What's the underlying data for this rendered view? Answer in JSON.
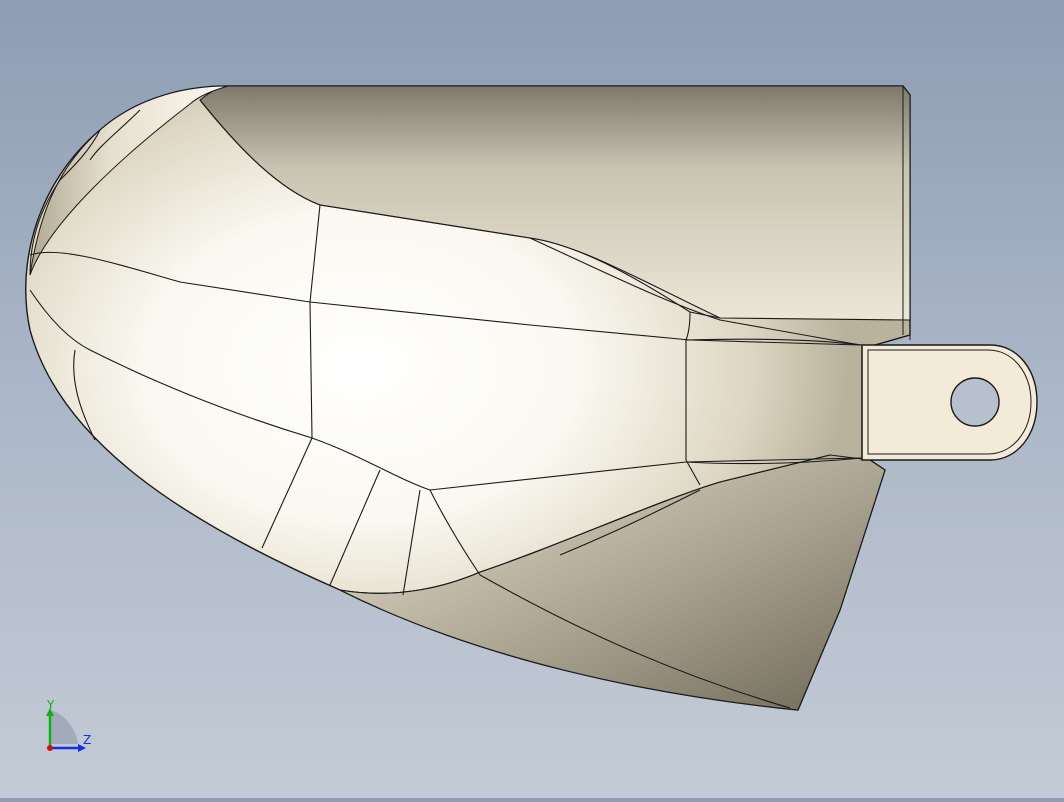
{
  "viewport": {
    "background_top": "#8e9db4",
    "background_bottom": "#c4cbd6",
    "model": {
      "icon": "cad-part-icon",
      "surface_color": "#efe9d8",
      "shadow_color": "#8e8672",
      "edge_color": "#1a1a1a"
    }
  },
  "triad": {
    "x_label": "",
    "y_label": "Y",
    "z_label": "Z",
    "x_color": "#d01010",
    "y_color": "#10b010",
    "z_color": "#1030e0"
  }
}
